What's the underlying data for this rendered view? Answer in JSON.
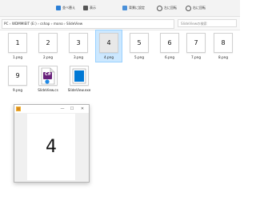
{
  "toolbar": {
    "sort_label": "並べ替え",
    "view_label": "表示",
    "wallpaper_label": "背景に設定",
    "rotate_left_label": "左に回転",
    "rotate_right_label": "右に回転"
  },
  "address": {
    "breadcrumb": [
      "PC",
      "WDMMIEIT (E:)",
      "cshap",
      "mono",
      "SlideView"
    ],
    "search_placeholder": "SlideViewの検索"
  },
  "files": [
    {
      "name": "1.png",
      "thumb": "1"
    },
    {
      "name": "2.png",
      "thumb": "2"
    },
    {
      "name": "3.png",
      "thumb": "3"
    },
    {
      "name": "4.png",
      "thumb": "4"
    },
    {
      "name": "5.png",
      "thumb": "5"
    },
    {
      "name": "6.png",
      "thumb": "6"
    },
    {
      "name": "7.png",
      "thumb": "7"
    },
    {
      "name": "8.png",
      "thumb": "8"
    },
    {
      "name": "9.png",
      "thumb": "9"
    },
    {
      "name": "SlideView.cs",
      "icon": "csharp-file-icon",
      "badge": "C#"
    },
    {
      "name": "SlideView.exe",
      "icon": "exe-file-icon"
    }
  ],
  "viewer": {
    "display_number": "4",
    "minimize_glyph": "—",
    "maximize_glyph": "☐",
    "close_glyph": "✕"
  },
  "colors": {
    "selection": "#cce8ff",
    "accent": "#0078d4"
  }
}
